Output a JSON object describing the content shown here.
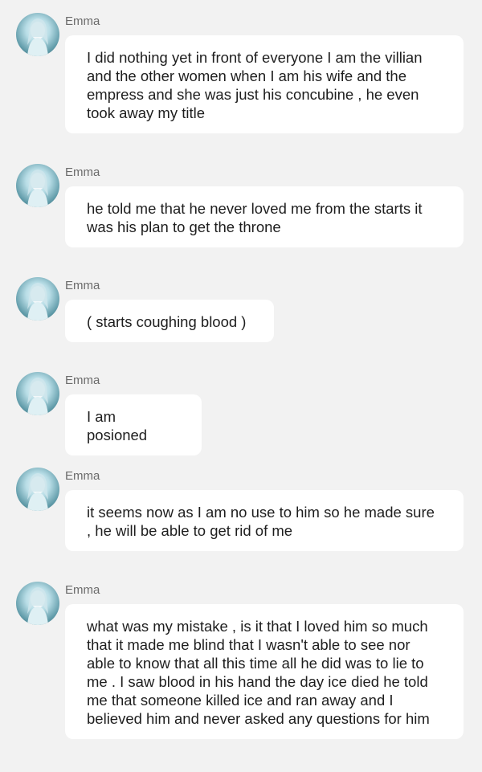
{
  "messages": [
    {
      "sender": "Emma",
      "text": "I did nothing yet in front of everyone I am the villian and the other women when I am his wife and the empress and she was just his concubine , he even took away my title"
    },
    {
      "sender": "Emma",
      "text": "he told me that he never loved me from the starts it was his plan to get the throne"
    },
    {
      "sender": "Emma",
      "text": "( starts coughing blood )"
    },
    {
      "sender": "Emma",
      "text": "I am posioned"
    },
    {
      "sender": "Emma",
      "text": "it seems now as I am no use to him so he made sure , he will be able to get rid of me"
    },
    {
      "sender": "Emma",
      "text": "what was my mistake , is it that I loved him so much that it made me blind that I wasn't able to see nor able to know that all this time all he did was to lie to me . I saw blood in his hand the day ice died he told me that someone killed ice and ran away and I believed him and never asked any questions for him"
    }
  ]
}
